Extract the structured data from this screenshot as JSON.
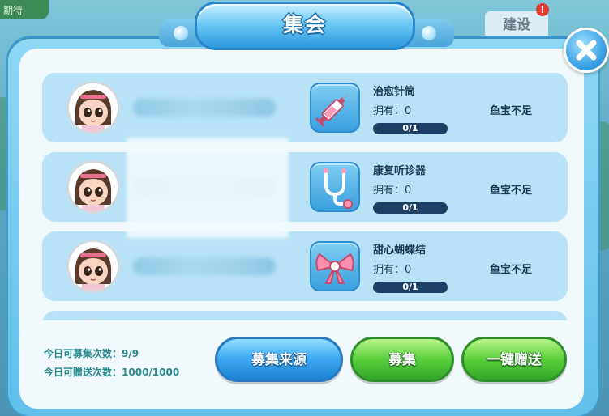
{
  "background": {
    "corner_text": "期待",
    "build_label": "建设",
    "build_alert": "!"
  },
  "dialog": {
    "title": "集会"
  },
  "rows": [
    {
      "item_name": "治愈针筒",
      "owned_label": "拥有：",
      "owned_value": "0",
      "progress_text": "0/1",
      "progress_fraction": 0,
      "status": "鱼宝不足",
      "item_icon": "syringe-icon"
    },
    {
      "item_name": "康复听诊器",
      "owned_label": "拥有：",
      "owned_value": "0",
      "progress_text": "0/1",
      "progress_fraction": 0,
      "status": "鱼宝不足",
      "item_icon": "stethoscope-icon"
    },
    {
      "item_name": "甜心蝴蝶结",
      "owned_label": "拥有：",
      "owned_value": "0",
      "progress_text": "0/1",
      "progress_fraction": 0,
      "status": "鱼宝不足",
      "item_icon": "bow-icon"
    }
  ],
  "footer": {
    "recruit_count_label": "今日可募集次数：",
    "recruit_count_value": "9/9",
    "gift_count_label": "今日可赠送次数：",
    "gift_count_value": "1000/1000",
    "source_button": "募集来源",
    "recruit_button": "募集",
    "gift_all_button": "一键赠送"
  },
  "colors": {
    "panel": "#61bfea",
    "row": "#b8e3f7",
    "progress_track": "#1c3f66",
    "accent_green": "#59cf3a",
    "accent_blue": "#3ba7ef"
  }
}
